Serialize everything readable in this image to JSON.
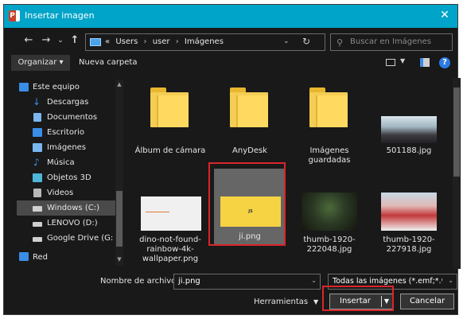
{
  "window": {
    "title": "Insertar imagen"
  },
  "nav": {
    "back": "←",
    "forward": "→",
    "recent": "⌄",
    "up": "↑",
    "breadcrumb": [
      "«",
      "Users",
      "user",
      "Imágenes"
    ],
    "separator": "›",
    "search_placeholder": "Buscar en Imágenes"
  },
  "toolbar": {
    "organize": "Organizar ▾",
    "new_folder": "Nueva carpeta",
    "help": "?"
  },
  "sidebar": {
    "items": [
      {
        "label": "Este equipo",
        "icon": "computer-icon",
        "color": "#3a8ee6"
      },
      {
        "label": "Descargas",
        "icon": "download-arrow-icon",
        "color": "#3a8ee6"
      },
      {
        "label": "Documentos",
        "icon": "document-icon",
        "color": "#7ab6ef"
      },
      {
        "label": "Escritorio",
        "icon": "desktop-icon",
        "color": "#3a8ee6"
      },
      {
        "label": "Imágenes",
        "icon": "pictures-icon",
        "color": "#7ab6ef"
      },
      {
        "label": "Música",
        "icon": "music-note-icon",
        "color": "#3a8ee6"
      },
      {
        "label": "Objetos 3D",
        "icon": "3d-objects-icon",
        "color": "#4fb6d8"
      },
      {
        "label": "Videos",
        "icon": "video-icon",
        "color": "#b8b8b8"
      },
      {
        "label": "Windows (C:)",
        "icon": "drive-icon",
        "color": "#cfcfcf"
      },
      {
        "label": "LENOVO (D:)",
        "icon": "drive-icon",
        "color": "#cfcfcf"
      },
      {
        "label": "Google Drive (G:",
        "icon": "drive-icon",
        "color": "#cfcfcf"
      },
      {
        "label": "Red",
        "icon": "network-icon",
        "color": "#3a8ee6"
      }
    ]
  },
  "files": [
    {
      "label": "Álbum de cámara",
      "kind": "folder"
    },
    {
      "label": "AnyDesk",
      "kind": "folder"
    },
    {
      "label": "Imágenes guardadas",
      "kind": "folder"
    },
    {
      "label": "501188.jpg",
      "kind": "image"
    },
    {
      "label": "dino-not-found-rainbow-4k-wallpaper.png",
      "kind": "image"
    },
    {
      "label": "ji.png",
      "kind": "image",
      "thumb_text": "JS"
    },
    {
      "label": "thumb-1920-222048.jpg",
      "kind": "image"
    },
    {
      "label": "thumb-1920-227918.jpg",
      "kind": "image"
    }
  ],
  "bottom": {
    "filename_label": "Nombre de archivo:",
    "filename_value": "ji.png",
    "filter_value": "Todas las imágenes (*.emf;*.wm",
    "tools": "Herramientas",
    "insert": "Insertar",
    "cancel": "Cancelar"
  },
  "colors": {
    "titlebar": "#00a4c8",
    "highlight": "#d9262a",
    "selection": "#666666"
  }
}
